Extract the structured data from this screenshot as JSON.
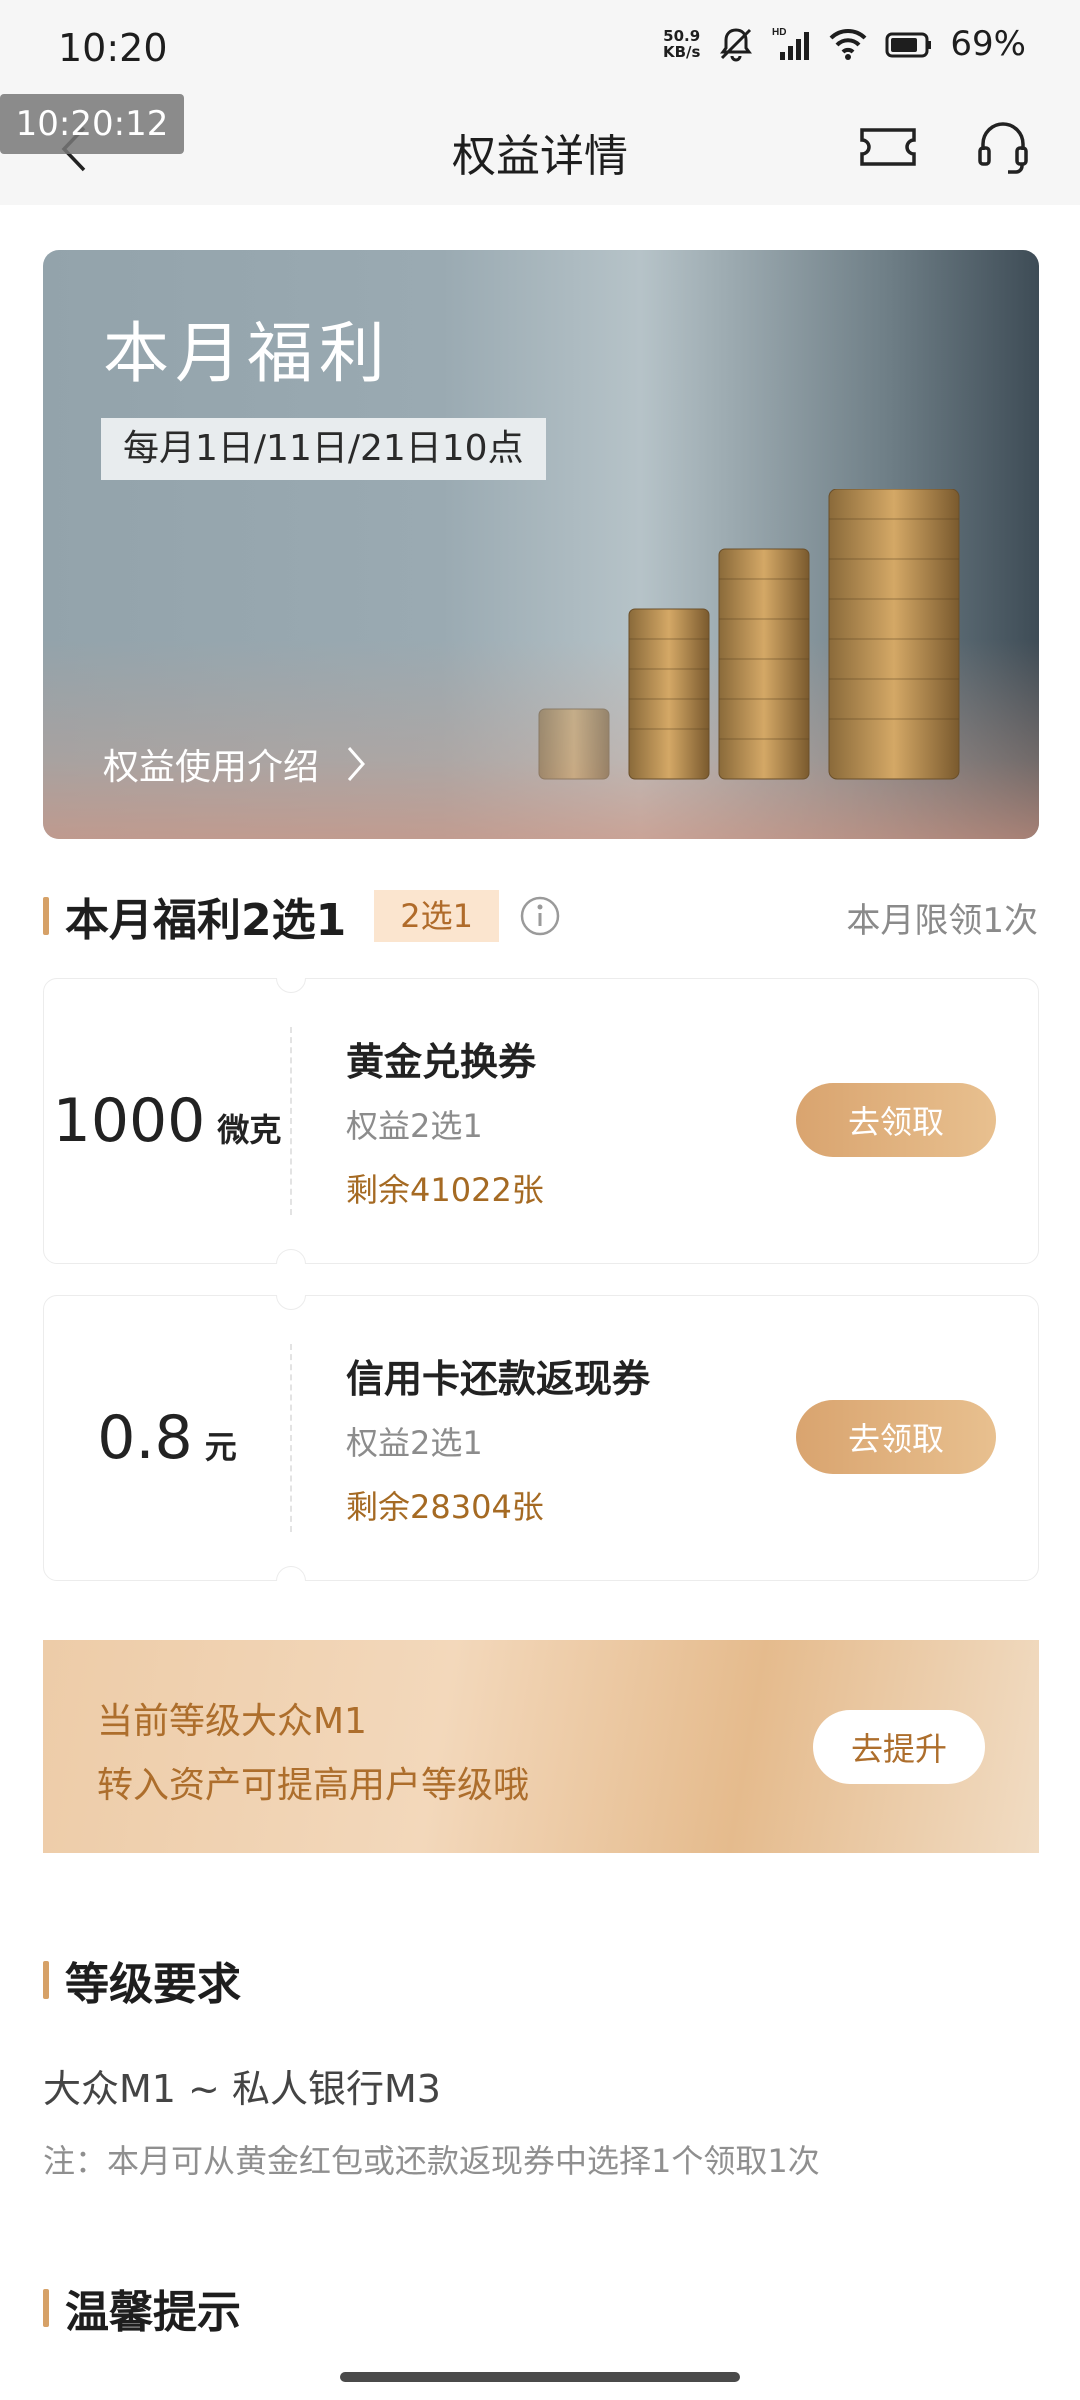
{
  "status_bar": {
    "time": "10:20",
    "net_speed_value": "50.9",
    "net_speed_unit": "KB/s",
    "battery": "69%"
  },
  "overlay_timestamp": "10:20:12",
  "nav": {
    "title": "权益详情",
    "icons": [
      "back-icon",
      "ticket-icon",
      "headset-icon"
    ]
  },
  "banner": {
    "title": "本月福利",
    "schedule": "每月1日/11日/21日10点",
    "intro_link": "权益使用介绍"
  },
  "welfare_section": {
    "title": "本月福利2选1",
    "tag": "2选1",
    "limit": "本月限领1次",
    "coupons": [
      {
        "amount": "1000",
        "unit": "微克",
        "name": "黄金兑换券",
        "sub": "权益2选1",
        "remaining": "剩余41022张",
        "button": "去领取"
      },
      {
        "amount": "0.8",
        "unit": "元",
        "name": "信用卡还款返现券",
        "sub": "权益2选1",
        "remaining": "剩余28304张",
        "button": "去领取"
      }
    ]
  },
  "level_banner": {
    "line1": "当前等级大众M1",
    "line2": "转入资产可提高用户等级哦",
    "button": "去提升"
  },
  "level_section": {
    "title": "等级要求",
    "range": "大众M1 ~ 私人银行M3",
    "note": "注：本月可从黄金红包或还款返现券中选择1个领取1次"
  },
  "tips_section": {
    "title": "温馨提示"
  },
  "colors": {
    "accent": "#d6a167",
    "gold_text": "#a56a23",
    "button_gradient_start": "#d9a46f",
    "button_gradient_end": "#e8c08f"
  }
}
